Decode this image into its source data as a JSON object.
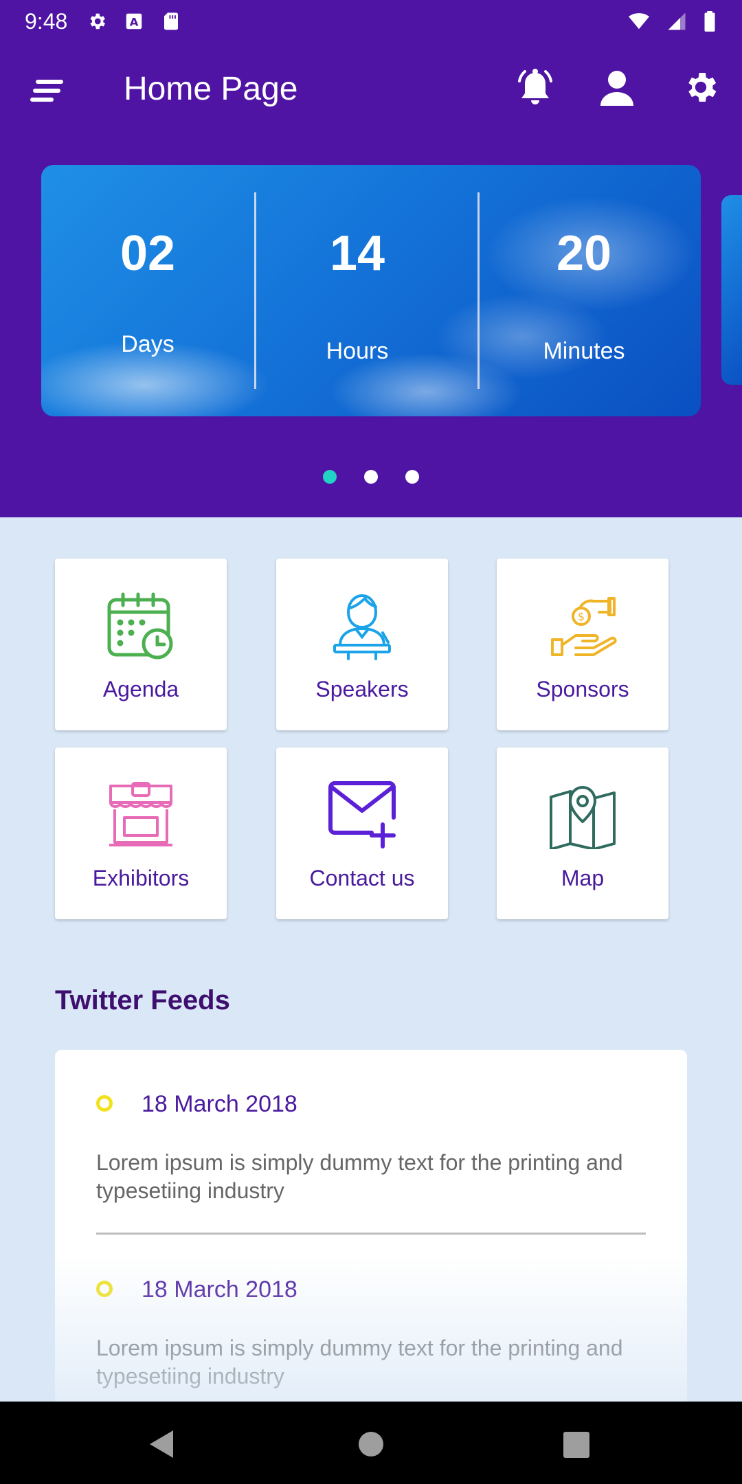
{
  "status_bar": {
    "time": "9:48"
  },
  "app_bar": {
    "title": "Home Page"
  },
  "countdown": [
    {
      "value": "02",
      "unit": "Days"
    },
    {
      "value": "14",
      "unit": "Hours"
    },
    {
      "value": "20",
      "unit": "Minutes"
    }
  ],
  "carousel": {
    "page_count": 3,
    "active_index": 0,
    "active_dot_color": "#22d3c5"
  },
  "tiles": [
    {
      "label": "Agenda",
      "icon": "calendar-clock-icon",
      "color": "#4caf50"
    },
    {
      "label": "Speakers",
      "icon": "speaker-podium-icon",
      "color": "#1aa3e8"
    },
    {
      "label": "Sponsors",
      "icon": "hand-coin-icon",
      "color": "#f0b429"
    },
    {
      "label": "Exhibitors",
      "icon": "booth-icon",
      "color": "#e86bb8"
    },
    {
      "label": "Contact us",
      "icon": "mail-plus-icon",
      "color": "#5b21d6"
    },
    {
      "label": "Map",
      "icon": "map-pin-icon",
      "color": "#2f6b5e"
    }
  ],
  "twitter": {
    "title": "Twitter Feeds",
    "items": [
      {
        "date": "18 March 2018",
        "text": "Lorem ipsum is simply dummy text for the printing and typesetiing industry"
      },
      {
        "date": "18 March 2018",
        "text": "Lorem ipsum is simply dummy text for the printing and typesetiing industry"
      }
    ]
  },
  "colors": {
    "header": "#4f14a3",
    "background": "#d9e7f6",
    "label": "#4a1a9e",
    "feed_dot": "#f2e11d"
  }
}
